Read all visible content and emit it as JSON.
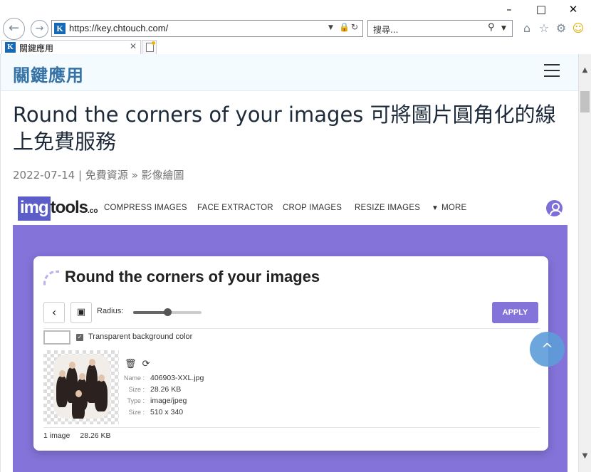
{
  "browser": {
    "url": "https://key.chtouch.com/",
    "search_placeholder": "搜尋...",
    "tab_title": "關鍵應用",
    "favicon_letter": "K",
    "icons": {
      "back": "back-arrow-icon",
      "forward": "forward-arrow-icon",
      "dropdown": "chevron-down-icon",
      "lock": "lock-icon",
      "refresh": "refresh-icon",
      "search": "search-icon",
      "home": "home-icon",
      "favorites": "star-icon",
      "tools": "gear-icon",
      "feedback": "smiley-icon"
    }
  },
  "site": {
    "title": "關鍵應用",
    "accent_color": "#3572a5"
  },
  "article": {
    "title": "Round the corners of your images 可將圖片圓角化的線上免費服務",
    "date": "2022-07-14",
    "category": "免費資源",
    "subcategory": "影像繪圖"
  },
  "shot": {
    "logo": {
      "img": "img",
      "tools": "tools",
      "co": ".co"
    },
    "nav": [
      "COMPRESS IMAGES",
      "FACE EXTRACTOR",
      "CROP IMAGES",
      "RESIZE IMAGES",
      "MORE"
    ],
    "brand_color": "#8473d9",
    "card_title": "Round the corners of your images",
    "radius_label": "Radius:",
    "radius_level": 0.5,
    "apply_label": "APPLY",
    "transparent_label": "Transparent background color",
    "file": {
      "name_label": "Name :",
      "name": "406903-XXL.jpg",
      "size_label": "Size :",
      "size": "28.26 KB",
      "type_label": "Type :",
      "type": "image/jpeg",
      "dims_label": "Size :",
      "dims": "510 x 340"
    },
    "footer_count": "1 image",
    "footer_size": "28.26 KB"
  },
  "back_to_top": "^"
}
